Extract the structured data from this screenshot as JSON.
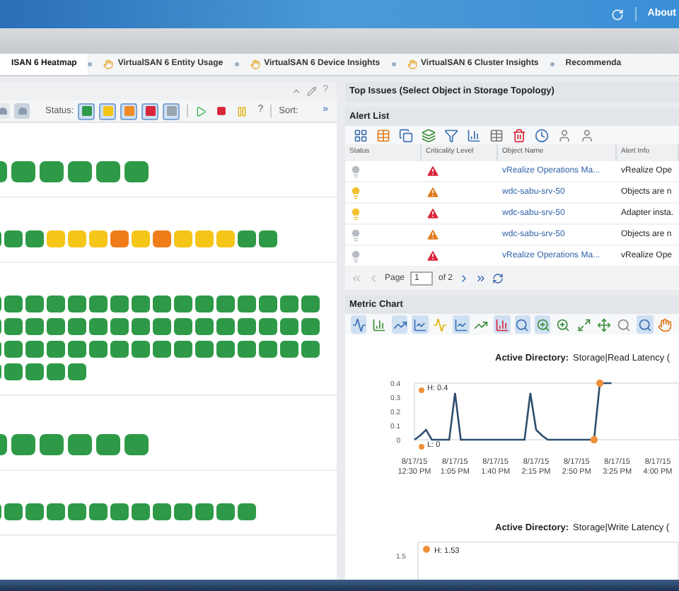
{
  "header": {
    "about": "About"
  },
  "tabs": [
    {
      "label": "ISAN 6 Heatmap",
      "selected": true,
      "pinned": false
    },
    {
      "label": "VirtualSAN 6 Entity Usage",
      "selected": false,
      "pinned": true
    },
    {
      "label": "VirtualSAN 6 Device Insights",
      "selected": false,
      "pinned": true
    },
    {
      "label": "VirtualSAN 6 Cluster Insights",
      "selected": false,
      "pinned": true
    },
    {
      "label": "Recommenda",
      "selected": false,
      "pinned": false
    }
  ],
  "heatmap": {
    "help": "?",
    "views": [
      {
        "selected": false
      },
      {
        "selected": true
      }
    ],
    "status_label": "Status:",
    "status_filters": [
      {
        "color": "#2e9a48",
        "selected": true
      },
      {
        "color": "#f5c518",
        "selected": true
      },
      {
        "color": "#f08a24",
        "selected": true
      },
      {
        "color": "#d9253a",
        "selected": true
      },
      {
        "color": "#9aa4ae",
        "selected": true
      }
    ],
    "help2": "?",
    "sort_label": "Sort:",
    "more": "»",
    "groups": [
      {
        "kind": "large",
        "tiles": [
          {
            "color": "#2e9a48"
          },
          {
            "color": "#2e9a48"
          },
          {
            "color": "#2e9a48"
          },
          {
            "color": "#2e9a48"
          },
          {
            "color": "#2e9a48"
          },
          {
            "color": "#2e9a48"
          }
        ]
      },
      {
        "kind": "small",
        "tiles": [
          {
            "color": "#2e9a48"
          },
          {
            "color": "#2e9a48"
          },
          {
            "color": "#2e9a48"
          },
          {
            "color": "#f5c518"
          },
          {
            "color": "#f5c518"
          },
          {
            "color": "#f5c518"
          },
          {
            "color": "#f07d1a"
          },
          {
            "color": "#f5c518"
          },
          {
            "color": "#f07d1a"
          },
          {
            "color": "#f5c518"
          },
          {
            "color": "#f5c518"
          },
          {
            "color": "#f5c518"
          },
          {
            "color": "#2e9a48"
          },
          {
            "color": "#2e9a48"
          }
        ]
      },
      {
        "kind": "small",
        "tiles": [
          {
            "color": "#2e9a48"
          },
          {
            "color": "#2e9a48"
          },
          {
            "color": "#2e9a48"
          },
          {
            "color": "#2e9a48"
          },
          {
            "color": "#2e9a48"
          },
          {
            "color": "#2e9a48"
          },
          {
            "color": "#2e9a48"
          },
          {
            "color": "#2e9a48"
          },
          {
            "color": "#2e9a48"
          },
          {
            "color": "#2e9a48"
          },
          {
            "color": "#2e9a48"
          },
          {
            "color": "#2e9a48"
          },
          {
            "color": "#2e9a48"
          },
          {
            "color": "#2e9a48"
          },
          {
            "color": "#2e9a48"
          },
          {
            "color": "#2e9a48"
          },
          {
            "color": "#2e9a48"
          },
          {
            "color": "#2e9a48"
          },
          {
            "color": "#2e9a48"
          },
          {
            "color": "#2e9a48"
          },
          {
            "color": "#2e9a48"
          },
          {
            "color": "#2e9a48"
          },
          {
            "color": "#2e9a48"
          },
          {
            "color": "#2e9a48"
          },
          {
            "color": "#2e9a48"
          },
          {
            "color": "#2e9a48"
          },
          {
            "color": "#2e9a48"
          },
          {
            "color": "#2e9a48"
          },
          {
            "color": "#2e9a48"
          },
          {
            "color": "#2e9a48"
          },
          {
            "color": "#2e9a48"
          },
          {
            "color": "#2e9a48"
          },
          {
            "color": "#2e9a48"
          },
          {
            "color": "#2e9a48"
          },
          {
            "color": "#2e9a48"
          },
          {
            "color": "#2e9a48"
          },
          {
            "color": "#2e9a48"
          },
          {
            "color": "#2e9a48"
          },
          {
            "color": "#2e9a48"
          },
          {
            "color": "#2e9a48"
          },
          {
            "color": "#2e9a48"
          },
          {
            "color": "#2e9a48"
          },
          {
            "color": "#2e9a48"
          },
          {
            "color": "#2e9a48"
          },
          {
            "color": "#2e9a48"
          },
          {
            "color": "#2e9a48"
          },
          {
            "color": "#2e9a48"
          },
          {
            "color": "#2e9a48"
          },
          {
            "color": "#2e9a48"
          },
          {
            "color": "#2e9a48"
          },
          {
            "color": "#2e9a48"
          },
          {
            "color": "#2e9a48"
          },
          {
            "color": "#2e9a48"
          }
        ]
      },
      {
        "kind": "large",
        "tiles": [
          {
            "color": "#2e9a48"
          },
          {
            "color": "#2e9a48"
          },
          {
            "color": "#2e9a48"
          },
          {
            "color": "#2e9a48"
          },
          {
            "color": "#2e9a48"
          },
          {
            "color": "#2e9a48"
          }
        ]
      },
      {
        "kind": "small",
        "tiles": [
          {
            "color": "#2e9a48"
          },
          {
            "color": "#2e9a48"
          },
          {
            "color": "#2e9a48"
          },
          {
            "color": "#2e9a48"
          },
          {
            "color": "#2e9a48"
          },
          {
            "color": "#2e9a48"
          },
          {
            "color": "#2e9a48"
          },
          {
            "color": "#2e9a48"
          },
          {
            "color": "#2e9a48"
          },
          {
            "color": "#2e9a48"
          },
          {
            "color": "#2e9a48"
          },
          {
            "color": "#2e9a48"
          },
          {
            "color": "#2e9a48"
          }
        ]
      }
    ]
  },
  "top_issues": {
    "title": "Top Issues (Select Object in Storage Topology)"
  },
  "alert_list": {
    "title": "Alert List",
    "columns": [
      "Status",
      "Criticality Level",
      "Object Name",
      "Alert Info"
    ],
    "rows": [
      {
        "status_icon": {
          "color": "#b8bcc2"
        },
        "criticality_icon": {
          "color": "#d9253a"
        },
        "object": "vRealize Operations Ma...",
        "info": "vRealize Ope"
      },
      {
        "status_icon": {
          "color": "#f2c12e"
        },
        "criticality_icon": {
          "color": "#e07b1c"
        },
        "object": "wdc-sabu-srv-50",
        "info": "Objects are n"
      },
      {
        "status_icon": {
          "color": "#f2c12e"
        },
        "criticality_icon": {
          "color": "#d9253a"
        },
        "object": "wdc-sabu-srv-50",
        "info": "Adapter insta."
      },
      {
        "status_icon": {
          "color": "#b8bcc2"
        },
        "criticality_icon": {
          "color": "#e07b1c"
        },
        "object": "wdc-sabu-srv-50",
        "info": "Objects are n"
      },
      {
        "status_icon": {
          "color": "#b8bcc2"
        },
        "criticality_icon": {
          "color": "#d9253a"
        },
        "object": "vRealize Operations Ma...",
        "info": "vRealize Ope"
      }
    ],
    "pager": {
      "page_label": "Page",
      "page": "1",
      "of": "of 2"
    }
  },
  "metric_chart": {
    "title": "Metric Chart",
    "charts": [
      {
        "object": "Active Directory:",
        "metric": "Storage|Read Latency (",
        "chart_data": {
          "type": "line",
          "ylim": [
            0,
            0.4
          ],
          "yticks": [
            0,
            0.1,
            0.2,
            0.3,
            0.4
          ],
          "categories": [
            "8/17/15 12:30 PM",
            null,
            null,
            null,
            null,
            null,
            null,
            "8/17/15 1:05 PM",
            null,
            null,
            null,
            null,
            null,
            null,
            "8/17/15 1:40 PM",
            null,
            null,
            null,
            null,
            null,
            null,
            "8/17/15 2:15 PM",
            null,
            null,
            null,
            null,
            null,
            null,
            "8/17/15 2:50 PM",
            null,
            null,
            null,
            null,
            null,
            null,
            "8/17/15 3:25 PM",
            null,
            null,
            null,
            null,
            null,
            null,
            "8/17/15 4:00 PM"
          ],
          "series": [
            {
              "color": "#2f4f6f",
              "values": [
                0,
                0.03,
                0.07,
                0,
                0,
                0,
                0,
                0.33,
                0,
                0,
                0,
                0,
                0,
                0,
                0,
                0,
                0,
                0,
                0,
                0,
                0.33,
                0.07,
                0.03,
                0,
                0,
                0,
                0,
                0,
                0,
                0,
                0,
                0,
                0.4,
                0.4,
                0.4,
                null,
                null,
                null,
                null,
                null,
                null,
                null,
                null
              ]
            }
          ],
          "annotations": [
            "H: 0.4",
            "L: 0"
          ]
        }
      },
      {
        "object": "Active Directory:",
        "metric": "Storage|Write Latency (",
        "high": "H: 1.53",
        "tick": "1.5"
      }
    ]
  }
}
